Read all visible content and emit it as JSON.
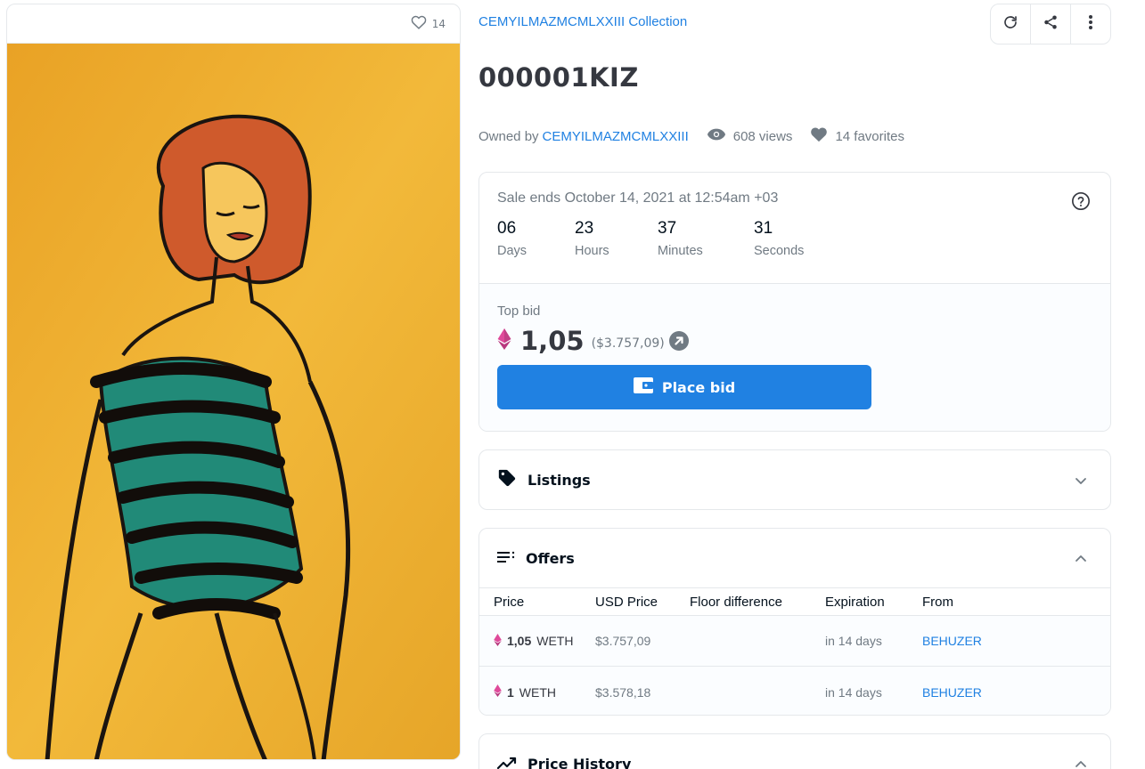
{
  "image_card": {
    "favorite_count": "14"
  },
  "collection": {
    "name": "CEMYILMAZMCMLXXIII Collection"
  },
  "item": {
    "title": "000001KIZ"
  },
  "meta": {
    "owned_by_label": "Owned by",
    "owner": "CEMYILMAZMCMLXXIII",
    "views": "608 views",
    "favorites": "14 favorites"
  },
  "sale": {
    "ends_text": "Sale ends October 14, 2021 at 12:54am +03",
    "countdown": [
      {
        "value": "06",
        "label": "Days"
      },
      {
        "value": "23",
        "label": "Hours"
      },
      {
        "value": "37",
        "label": "Minutes"
      },
      {
        "value": "31",
        "label": "Seconds"
      }
    ],
    "top_bid_label": "Top bid",
    "top_bid_amount": "1,05",
    "top_bid_usd": "($3.757,09)",
    "place_bid_label": "Place bid"
  },
  "listings": {
    "title": "Listings"
  },
  "offers": {
    "title": "Offers",
    "columns": [
      "Price",
      "USD Price",
      "Floor difference",
      "Expiration",
      "From"
    ],
    "rows": [
      {
        "amount": "1,05",
        "unit": "WETH",
        "usd": "$3.757,09",
        "floor": "",
        "expiration": "in 14 days",
        "from": "BEHUZER"
      },
      {
        "amount": "1",
        "unit": "WETH",
        "usd": "$3.578,18",
        "floor": "",
        "expiration": "in 14 days",
        "from": "BEHUZER"
      }
    ]
  },
  "price_history": {
    "title": "Price History"
  },
  "colors": {
    "accent": "#2081e2",
    "text_primary": "#353840",
    "text_secondary": "#707a83",
    "border": "#e5e8eb",
    "weth_pink": "#df4a9a"
  }
}
